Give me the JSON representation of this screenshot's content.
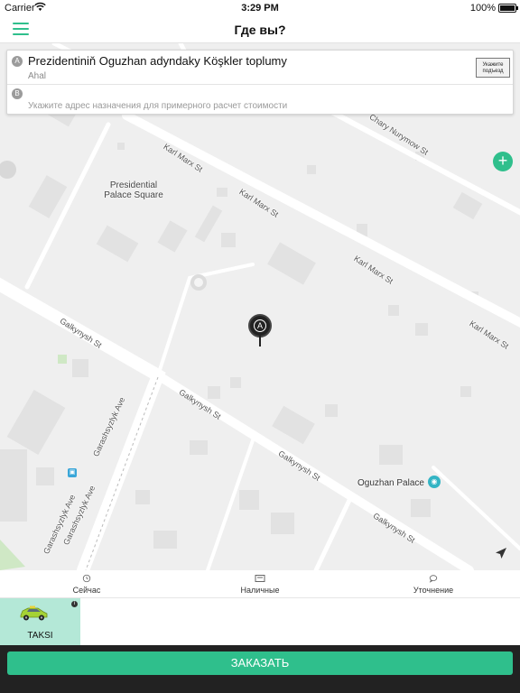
{
  "status_bar": {
    "carrier": "Carrier",
    "time": "3:29 PM",
    "battery": "100%",
    "icons": [
      "wifi-icon",
      "battery-icon"
    ]
  },
  "nav": {
    "title": "Где вы?",
    "menu_icon": "hamburger-menu-icon"
  },
  "address": {
    "from_marker": "A",
    "from_main": "Prezidentiniň Oguzhan adyndaky Köşkler toplumy",
    "from_sub": "Ahal",
    "entrance_button": "Укажите подъезд",
    "to_marker": "B",
    "to_placeholder": "Укажите адрес назначения для примерного расчет стоимости"
  },
  "map": {
    "pin_letter": "A",
    "zoom_in_label": "+",
    "place": "Presidential Palace Square",
    "poi": "Oguzhan Palace",
    "streets": [
      "Karl Marx St",
      "Karl Marx St",
      "Karl Marx St",
      "Karl Marx St",
      "Chary Nurymow St",
      "Galkynysh St",
      "Galkynysh St",
      "Galkynysh St",
      "Galkynysh St",
      "Garashsyzlyk Ave",
      "Garashsyzlyk Ave",
      "Garashsyzlyk Ave"
    ],
    "colors": {
      "roads": "#ffffff",
      "blocks": "#e0e0e0",
      "park": "#cfe8c5",
      "background": "#efefef"
    }
  },
  "options": [
    {
      "label": "Сейчас",
      "icon": "clock-icon"
    },
    {
      "label": "Наличные",
      "icon": "cash-icon"
    },
    {
      "label": "Уточнение",
      "icon": "comment-icon"
    }
  ],
  "tariff": {
    "name": "TAKSI",
    "info_label": "i",
    "icon": "taxi-car-icon"
  },
  "order_button": "ЗАКАЗАТЬ",
  "colors": {
    "accent": "#2fbf8c",
    "selected_tariff": "#b4e8d7",
    "bottom_bar": "#222222"
  }
}
